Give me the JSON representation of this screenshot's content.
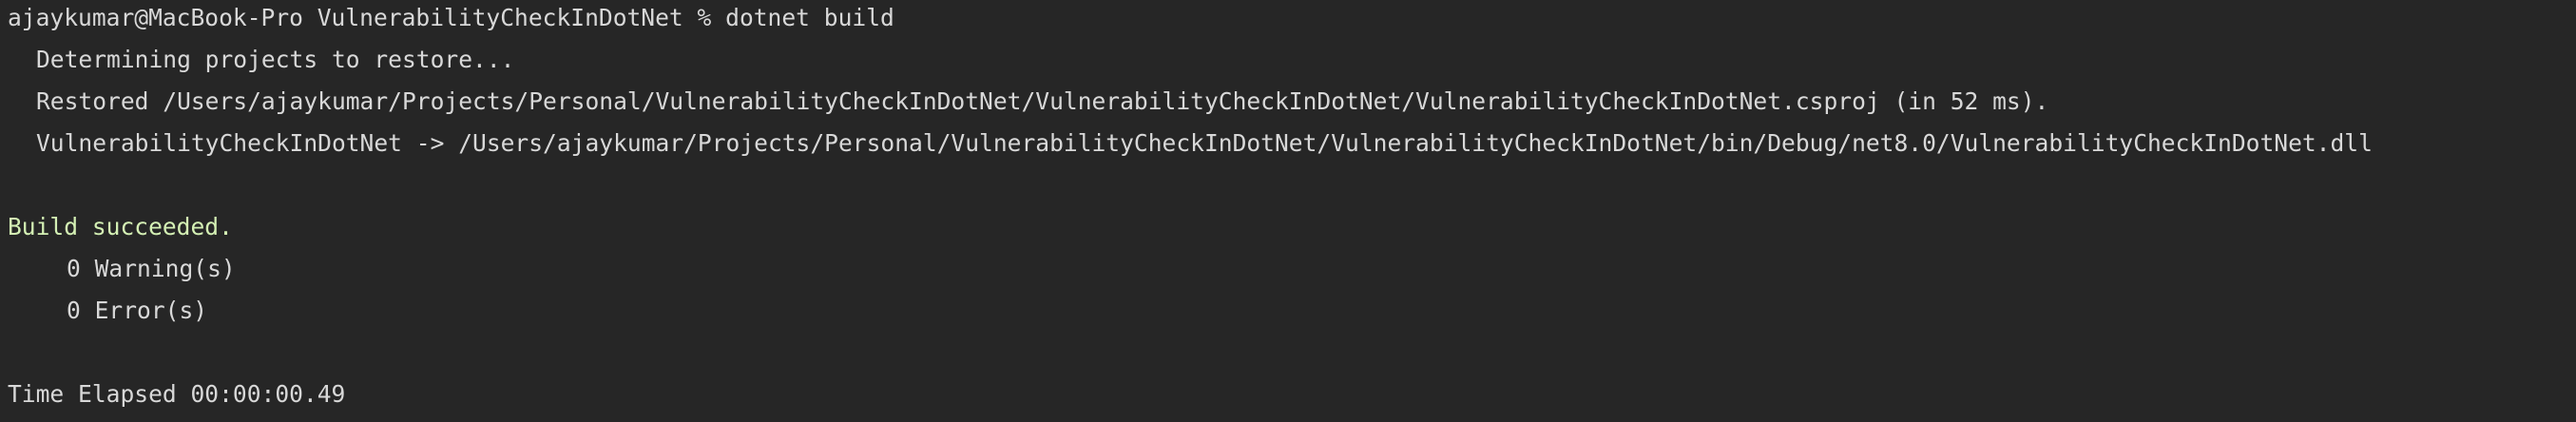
{
  "terminal": {
    "prompt": "ajaykumar@MacBook-Pro VulnerabilityCheckInDotNet % dotnet build",
    "lines": {
      "determining": "Determining projects to restore...",
      "restored": "Restored /Users/ajaykumar/Projects/Personal/VulnerabilityCheckInDotNet/VulnerabilityCheckInDotNet/VulnerabilityCheckInDotNet.csproj (in 52 ms).",
      "output": "VulnerabilityCheckInDotNet -> /Users/ajaykumar/Projects/Personal/VulnerabilityCheckInDotNet/VulnerabilityCheckInDotNet/bin/Debug/net8.0/VulnerabilityCheckInDotNet.dll",
      "build_status": "Build succeeded.",
      "warnings": "0 Warning(s)",
      "errors": "0 Error(s)",
      "elapsed": "Time Elapsed 00:00:00.49"
    },
    "colors": {
      "background": "#262626",
      "text": "#d8d8d8",
      "success": "#d4f0b4"
    }
  }
}
